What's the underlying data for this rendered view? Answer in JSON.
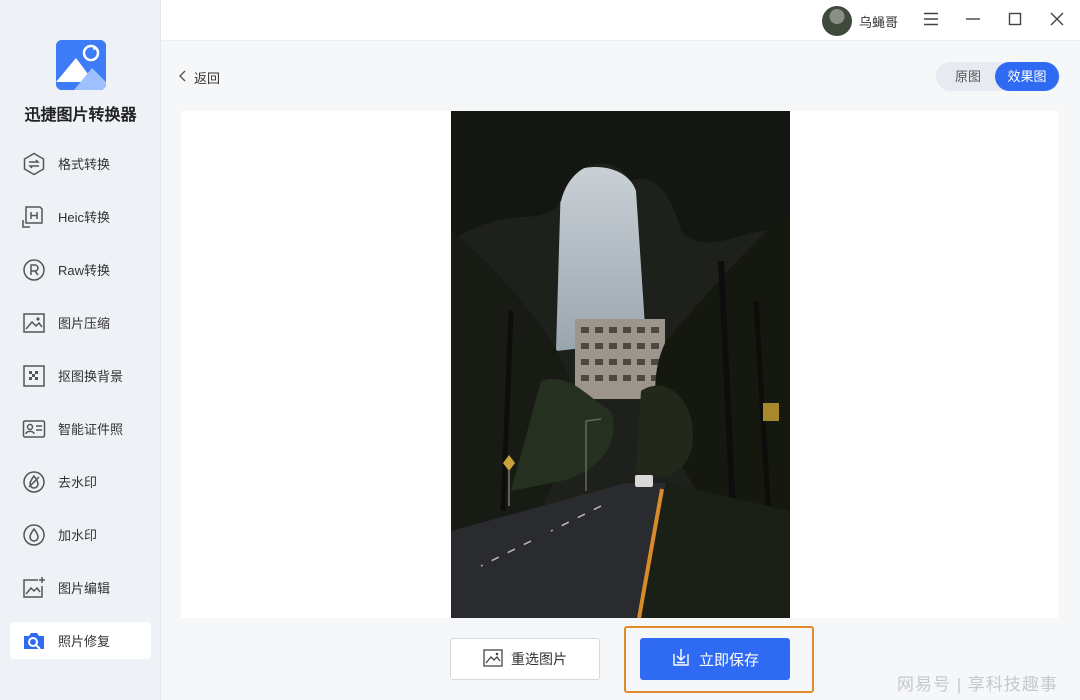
{
  "app": {
    "name": "迅捷图片转换器"
  },
  "sidebar": {
    "items": [
      {
        "label": "格式转换",
        "icon": "format-convert-icon"
      },
      {
        "label": "Heic转换",
        "icon": "heic-icon"
      },
      {
        "label": "Raw转换",
        "icon": "raw-icon"
      },
      {
        "label": "图片压缩",
        "icon": "image-compress-icon"
      },
      {
        "label": "抠图换背景",
        "icon": "cutout-icon"
      },
      {
        "label": "智能证件照",
        "icon": "id-photo-icon"
      },
      {
        "label": "去水印",
        "icon": "remove-watermark-icon"
      },
      {
        "label": "加水印",
        "icon": "add-watermark-icon"
      },
      {
        "label": "图片编辑",
        "icon": "image-edit-icon"
      },
      {
        "label": "照片修复",
        "icon": "photo-repair-icon",
        "active": true
      }
    ]
  },
  "titlebar": {
    "username": "乌蝇哥"
  },
  "main": {
    "back_label": "返回",
    "view_toggle": {
      "original": "原图",
      "effect": "效果图",
      "selected": "效果图"
    },
    "buttons": {
      "reselect": "重选图片",
      "save": "立即保存"
    }
  },
  "watermark": "网易号 | 享科技趣事",
  "colors": {
    "accent": "#2f6bf2",
    "highlight_frame": "#e38a2d",
    "sidebar_bg": "#eef1f6"
  }
}
